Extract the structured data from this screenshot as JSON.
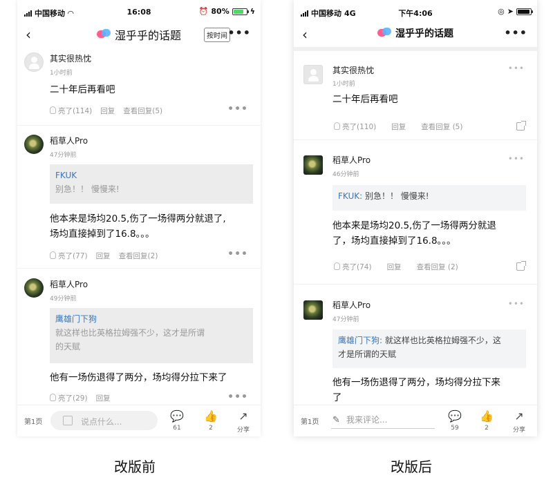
{
  "before": {
    "status": {
      "carrier": "中国移动",
      "time": "16:08",
      "battery": "80%"
    },
    "nav": {
      "back": "‹",
      "title": "湿乎乎的话题",
      "sort": "按时间",
      "more": "•••"
    },
    "comments": [
      {
        "name": "其实很热忱",
        "time": "1小时前",
        "text": "二十年后再看吧",
        "likes": "亮了(114)",
        "reply": "回复",
        "view": "查看回复(5)"
      },
      {
        "name": "稻草人Pro",
        "time": "47分钟前",
        "quote_name": "FKUK",
        "quote_text": "别急！！ 慢慢来!",
        "text_line1": "他本来是场均20.5,伤了一场得两分就退了,",
        "text_line2": "场均直接掉到了16.8。。。",
        "likes": "亮了(77)",
        "reply": "回复",
        "view": "查看回复(2)"
      },
      {
        "name": "稻草人Pro",
        "time": "49分钟前",
        "quote_name": "鹰雄门下狗",
        "quote_line1": "就这样也比英格拉姆强不少，这才是所谓",
        "quote_line2": "的天赋",
        "text": "他有一场伤退得了两分，场均得分拉下来了",
        "likes": "亮了(29)",
        "reply": "回复"
      }
    ],
    "bottom": {
      "page": "第1页",
      "placeholder": "说点什么...",
      "comments_count": "61",
      "likes_count": "2",
      "share": "分享"
    },
    "caption": "改版前"
  },
  "after": {
    "status": {
      "carrier": "中国移动",
      "network": "4G",
      "time": "下午4:06"
    },
    "nav": {
      "back": "‹",
      "title": "湿乎乎的话题",
      "more": "•••"
    },
    "comments": [
      {
        "name": "其实很热忱",
        "time": "1小时前",
        "text": "二十年后再看吧",
        "likes": "亮了(110)",
        "reply": "回复",
        "view": "查看回复 (5)"
      },
      {
        "name": "稻草人Pro",
        "time": "46分钟前",
        "quote_name": "FKUK:",
        "quote_text": " 别急！！ 慢慢来!",
        "text_line1": "他本来是场均20.5,伤了一场得两分就退",
        "text_line2": "了，场均直接掉到了16.8。。。",
        "likes": "亮了(74)",
        "reply": "回复",
        "view": "查看回复 (2)"
      },
      {
        "name": "稻草人Pro",
        "time": "47分钟前",
        "quote_name": "鹰雄门下狗:",
        "quote_text1": " 就这样也比英格拉姆强不少，这",
        "quote_line2": "才是所谓的天赋",
        "text_line1": "他有一场伤退得了两分，场均得分拉下来",
        "text_line2": "了"
      }
    ],
    "bottom": {
      "page": "第1页",
      "placeholder": "我来评论...",
      "comments_count": "59",
      "likes_count": "2",
      "share": "分享"
    },
    "caption": "改版后"
  }
}
